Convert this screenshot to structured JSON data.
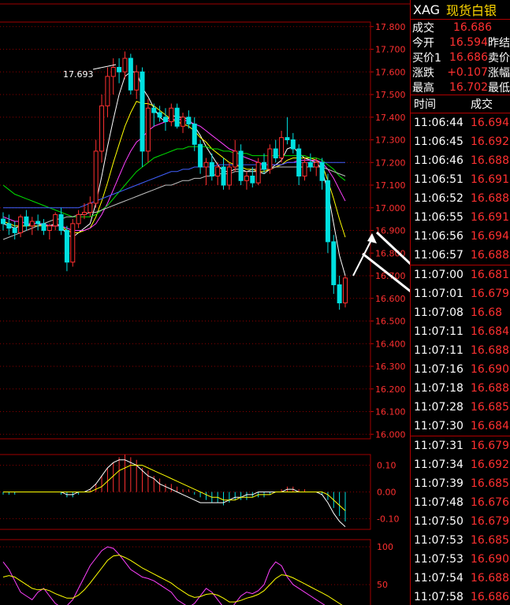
{
  "header": {
    "symbol": "XAG",
    "name": "现货白银"
  },
  "quote": [
    {
      "label": "成交",
      "value": "16.686",
      "label2": ""
    },
    {
      "label": "今开",
      "value": "16.594",
      "label2": "昨结"
    },
    {
      "label": "买价1",
      "value": "16.686",
      "label2": "卖价"
    },
    {
      "label": "涨跌",
      "value": "+0.107",
      "label2": "涨幅"
    },
    {
      "label": "最高",
      "value": "16.702",
      "label2": "最低"
    }
  ],
  "ticks_header": {
    "time": "时间",
    "price": "成交"
  },
  "ticks": [
    {
      "time": "11:06:44",
      "price": "16.694"
    },
    {
      "time": "11:06:45",
      "price": "16.692"
    },
    {
      "time": "11:06:46",
      "price": "16.688"
    },
    {
      "time": "11:06:51",
      "price": "16.691"
    },
    {
      "time": "11:06:52",
      "price": "16.688"
    },
    {
      "time": "11:06:55",
      "price": "16.691"
    },
    {
      "time": "11:06:56",
      "price": "16.694"
    },
    {
      "time": "11:06:57",
      "price": "16.688"
    },
    {
      "time": "11:07:00",
      "price": "16.681"
    },
    {
      "time": "11:07:01",
      "price": "16.679"
    },
    {
      "time": "11:07:08",
      "price": "16.68"
    },
    {
      "time": "11:07:11",
      "price": "16.684"
    },
    {
      "time": "11:07:11",
      "price": "16.688"
    },
    {
      "time": "11:07:16",
      "price": "16.690"
    },
    {
      "time": "11:07:18",
      "price": "16.688"
    },
    {
      "time": "11:07:28",
      "price": "16.685"
    },
    {
      "time": "11:07:30",
      "price": "16.684"
    },
    {
      "time": "11:07:31",
      "price": "16.679"
    },
    {
      "time": "11:07:34",
      "price": "16.692"
    },
    {
      "time": "11:07:39",
      "price": "16.685"
    },
    {
      "time": "11:07:48",
      "price": "16.676"
    },
    {
      "time": "11:07:50",
      "price": "16.679"
    },
    {
      "time": "11:07:53",
      "price": "16.685"
    },
    {
      "time": "11:07:53",
      "price": "16.690"
    },
    {
      "time": "11:07:54",
      "price": "16.688"
    },
    {
      "time": "11:07:58",
      "price": "16.686"
    }
  ],
  "chart_data": {
    "type": "candlestick",
    "high_marker": "17.693",
    "price_axis": [
      "17.800",
      "17.700",
      "17.600",
      "17.500",
      "17.400",
      "17.300",
      "17.200",
      "17.100",
      "17.000",
      "16.900",
      "16.800",
      "16.700",
      "16.600",
      "16.500",
      "16.400",
      "16.300",
      "16.200",
      "16.100",
      "16.000"
    ],
    "ylim": [
      15.98,
      17.82
    ],
    "macd_axis": [
      "0.10",
      "0.00",
      "-0.10"
    ],
    "macd_ylim": [
      -0.14,
      0.14
    ],
    "kdj_axis": [
      "100",
      "50",
      "0"
    ],
    "kdj_ylim": [
      0,
      120
    ],
    "candles": [
      [
        16.95,
        16.98,
        16.9,
        16.93
      ],
      [
        16.93,
        16.97,
        16.88,
        16.91
      ],
      [
        16.91,
        16.94,
        16.86,
        16.89
      ],
      [
        16.89,
        16.97,
        16.87,
        16.96
      ],
      [
        16.96,
        16.99,
        16.9,
        16.92
      ],
      [
        16.92,
        16.96,
        16.88,
        16.94
      ],
      [
        16.94,
        16.97,
        16.9,
        16.93
      ],
      [
        16.93,
        16.95,
        16.88,
        16.9
      ],
      [
        16.9,
        16.93,
        16.86,
        16.92
      ],
      [
        16.92,
        16.98,
        16.9,
        16.97
      ],
      [
        16.97,
        17.0,
        16.88,
        16.9
      ],
      [
        16.9,
        16.92,
        16.72,
        16.76
      ],
      [
        16.76,
        16.95,
        16.74,
        16.93
      ],
      [
        16.93,
        16.99,
        16.91,
        16.97
      ],
      [
        16.97,
        17.02,
        16.95,
        16.98
      ],
      [
        16.98,
        17.05,
        16.96,
        17.02
      ],
      [
        17.02,
        17.3,
        17.0,
        17.25
      ],
      [
        17.25,
        17.5,
        17.2,
        17.45
      ],
      [
        17.45,
        17.62,
        17.4,
        17.58
      ],
      [
        17.58,
        17.66,
        17.5,
        17.62
      ],
      [
        17.62,
        17.66,
        17.55,
        17.6
      ],
      [
        17.6,
        17.69,
        17.57,
        17.66
      ],
      [
        17.66,
        17.68,
        17.5,
        17.52
      ],
      [
        17.52,
        17.63,
        17.48,
        17.6
      ],
      [
        17.6,
        17.62,
        17.18,
        17.25
      ],
      [
        17.25,
        17.48,
        17.2,
        17.44
      ],
      [
        17.44,
        17.46,
        17.36,
        17.42
      ],
      [
        17.42,
        17.45,
        17.38,
        17.4
      ],
      [
        17.4,
        17.44,
        17.34,
        17.38
      ],
      [
        17.38,
        17.46,
        17.36,
        17.44
      ],
      [
        17.44,
        17.46,
        17.35,
        17.36
      ],
      [
        17.36,
        17.42,
        17.33,
        17.4
      ],
      [
        17.4,
        17.43,
        17.35,
        17.37
      ],
      [
        17.37,
        17.4,
        17.25,
        17.28
      ],
      [
        17.28,
        17.3,
        17.15,
        17.18
      ],
      [
        17.18,
        17.22,
        17.1,
        17.2
      ],
      [
        17.2,
        17.24,
        17.12,
        17.14
      ],
      [
        17.14,
        17.2,
        17.1,
        17.18
      ],
      [
        17.18,
        17.22,
        17.08,
        17.1
      ],
      [
        17.1,
        17.2,
        17.08,
        17.18
      ],
      [
        17.18,
        17.3,
        17.16,
        17.25
      ],
      [
        17.25,
        17.28,
        17.1,
        17.12
      ],
      [
        17.12,
        17.16,
        17.08,
        17.14
      ],
      [
        17.14,
        17.18,
        17.09,
        17.11
      ],
      [
        17.11,
        17.22,
        17.1,
        17.2
      ],
      [
        17.2,
        17.24,
        17.15,
        17.17
      ],
      [
        17.17,
        17.28,
        17.15,
        17.26
      ],
      [
        17.26,
        17.3,
        17.2,
        17.22
      ],
      [
        17.22,
        17.34,
        17.2,
        17.31
      ],
      [
        17.31,
        17.4,
        17.28,
        17.3
      ],
      [
        17.3,
        17.33,
        17.24,
        17.26
      ],
      [
        17.26,
        17.28,
        17.1,
        17.14
      ],
      [
        17.14,
        17.22,
        17.12,
        17.2
      ],
      [
        17.2,
        17.24,
        17.16,
        17.18
      ],
      [
        17.18,
        17.22,
        17.14,
        17.2
      ],
      [
        17.2,
        17.22,
        17.08,
        17.12
      ],
      [
        17.12,
        17.15,
        16.8,
        16.85
      ],
      [
        16.85,
        16.88,
        16.62,
        16.66
      ],
      [
        16.66,
        16.7,
        16.55,
        16.58
      ],
      [
        16.58,
        16.7,
        16.56,
        16.69
      ]
    ],
    "ma_series": [
      {
        "color": "#ffffff",
        "values": [
          16.93,
          16.92,
          16.91,
          16.92,
          16.92,
          16.93,
          16.93,
          16.92,
          16.92,
          16.93,
          16.92,
          16.88,
          16.87,
          16.89,
          16.91,
          16.93,
          17.02,
          17.14,
          17.27,
          17.39,
          17.5,
          17.58,
          17.6,
          17.6,
          17.53,
          17.49,
          17.44,
          17.4,
          17.38,
          17.41,
          17.4,
          17.4,
          17.39,
          17.36,
          17.32,
          17.27,
          17.23,
          17.19,
          17.16,
          17.16,
          17.17,
          17.17,
          17.16,
          17.16,
          17.16,
          17.15,
          17.17,
          17.19,
          17.21,
          17.26,
          17.27,
          17.24,
          17.22,
          17.21,
          17.2,
          17.17,
          17.07,
          16.93,
          16.79,
          16.7
        ]
      },
      {
        "color": "#ffff00",
        "values": [
          16.94,
          16.93,
          16.92,
          16.92,
          16.92,
          16.92,
          16.92,
          16.92,
          16.92,
          16.92,
          16.92,
          16.9,
          16.89,
          16.89,
          16.9,
          16.91,
          16.96,
          17.03,
          17.11,
          17.2,
          17.28,
          17.36,
          17.42,
          17.47,
          17.46,
          17.46,
          17.45,
          17.43,
          17.41,
          17.39,
          17.38,
          17.37,
          17.36,
          17.34,
          17.31,
          17.29,
          17.26,
          17.24,
          17.22,
          17.2,
          17.19,
          17.18,
          17.17,
          17.17,
          17.16,
          17.16,
          17.17,
          17.18,
          17.19,
          17.21,
          17.22,
          17.22,
          17.22,
          17.22,
          17.21,
          17.19,
          17.12,
          17.04,
          16.95,
          16.87
        ]
      },
      {
        "color": "#ff40ff",
        "values": [
          16.96,
          16.95,
          16.94,
          16.94,
          16.93,
          16.93,
          16.93,
          16.93,
          16.92,
          16.92,
          16.92,
          16.91,
          16.9,
          16.9,
          16.9,
          16.91,
          16.93,
          16.97,
          17.02,
          17.08,
          17.14,
          17.2,
          17.25,
          17.29,
          17.31,
          17.34,
          17.36,
          17.37,
          17.38,
          17.39,
          17.39,
          17.39,
          17.38,
          17.37,
          17.36,
          17.34,
          17.32,
          17.3,
          17.28,
          17.26,
          17.25,
          17.23,
          17.22,
          17.21,
          17.2,
          17.19,
          17.19,
          17.19,
          17.19,
          17.2,
          17.2,
          17.21,
          17.21,
          17.21,
          17.21,
          17.2,
          17.17,
          17.13,
          17.08,
          17.03
        ]
      },
      {
        "color": "#00e000",
        "values": [
          17.1,
          17.08,
          17.06,
          17.05,
          17.04,
          17.03,
          17.02,
          17.01,
          17.0,
          16.99,
          16.98,
          16.97,
          16.96,
          16.96,
          16.96,
          16.96,
          16.97,
          16.99,
          17.01,
          17.04,
          17.07,
          17.1,
          17.13,
          17.16,
          17.18,
          17.2,
          17.22,
          17.23,
          17.24,
          17.25,
          17.26,
          17.26,
          17.27,
          17.27,
          17.27,
          17.27,
          17.26,
          17.26,
          17.25,
          17.25,
          17.24,
          17.24,
          17.24,
          17.23,
          17.23,
          17.23,
          17.23,
          17.23,
          17.23,
          17.23,
          17.23,
          17.23,
          17.23,
          17.22,
          17.22,
          17.21,
          17.19,
          17.17,
          17.14,
          17.12
        ]
      },
      {
        "color": "#4060ff",
        "values": [
          17.0,
          17.0,
          17.0,
          17.0,
          17.0,
          17.0,
          17.0,
          17.0,
          17.0,
          17.0,
          17.0,
          17.0,
          17.0,
          17.0,
          17.01,
          17.02,
          17.03,
          17.04,
          17.05,
          17.06,
          17.07,
          17.08,
          17.09,
          17.1,
          17.11,
          17.12,
          17.13,
          17.14,
          17.15,
          17.16,
          17.16,
          17.17,
          17.17,
          17.18,
          17.18,
          17.18,
          17.18,
          17.19,
          17.19,
          17.19,
          17.19,
          17.19,
          17.19,
          17.19,
          17.19,
          17.19,
          17.19,
          17.19,
          17.19,
          17.2,
          17.2,
          17.2,
          17.2,
          17.2,
          17.2,
          17.2,
          17.2,
          17.2,
          17.2,
          17.2
        ]
      },
      {
        "color": "#c0c0c0",
        "values": [
          16.86,
          16.87,
          16.88,
          16.89,
          16.9,
          16.91,
          16.92,
          16.93,
          16.94,
          16.95,
          16.95,
          16.96,
          16.96,
          16.97,
          16.97,
          16.98,
          16.98,
          16.99,
          17.0,
          17.01,
          17.02,
          17.03,
          17.04,
          17.05,
          17.06,
          17.07,
          17.08,
          17.09,
          17.1,
          17.1,
          17.11,
          17.12,
          17.12,
          17.13,
          17.13,
          17.14,
          17.14,
          17.15,
          17.15,
          17.15,
          17.16,
          17.16,
          17.16,
          17.17,
          17.17,
          17.17,
          17.17,
          17.18,
          17.18,
          17.18,
          17.18,
          17.18,
          17.18,
          17.18,
          17.18,
          17.18,
          17.17,
          17.16,
          17.15,
          17.14
        ]
      }
    ],
    "macd_hist": [
      -0.01,
      -0.01,
      -0.01,
      0,
      0,
      0,
      0,
      0,
      0,
      0,
      -0.01,
      -0.02,
      -0.02,
      -0.01,
      0,
      0.01,
      0.03,
      0.06,
      0.09,
      0.11,
      0.13,
      0.14,
      0.13,
      0.12,
      0.09,
      0.08,
      0.06,
      0.05,
      0.03,
      0.03,
      0.02,
      0.01,
      0.01,
      -0.01,
      -0.02,
      -0.03,
      -0.04,
      -0.04,
      -0.05,
      -0.04,
      -0.03,
      -0.03,
      -0.03,
      -0.02,
      -0.02,
      -0.02,
      -0.01,
      0,
      0.01,
      0.02,
      0.02,
      0.01,
      0.01,
      0,
      0,
      -0.01,
      -0.03,
      -0.06,
      -0.09,
      -0.11
    ],
    "macd_dif": [
      0,
      0,
      0,
      0,
      0,
      0,
      0,
      0,
      0,
      0,
      0,
      -0.01,
      -0.01,
      0,
      0,
      0.01,
      0.03,
      0.06,
      0.09,
      0.11,
      0.12,
      0.12,
      0.11,
      0.1,
      0.08,
      0.06,
      0.05,
      0.03,
      0.02,
      0.01,
      0,
      -0.01,
      -0.02,
      -0.03,
      -0.04,
      -0.04,
      -0.04,
      -0.04,
      -0.04,
      -0.03,
      -0.02,
      -0.02,
      -0.01,
      -0.01,
      0,
      0,
      0,
      0,
      0,
      0.01,
      0.01,
      0,
      0,
      0,
      0,
      -0.01,
      -0.04,
      -0.08,
      -0.11,
      -0.13
    ],
    "macd_dea": [
      0,
      0,
      0,
      0,
      0,
      0,
      0,
      0,
      0,
      0,
      0,
      0,
      0,
      0,
      0,
      0,
      0.01,
      0.02,
      0.04,
      0.06,
      0.08,
      0.09,
      0.1,
      0.1,
      0.1,
      0.09,
      0.08,
      0.07,
      0.06,
      0.05,
      0.04,
      0.03,
      0.02,
      0.01,
      0,
      -0.01,
      -0.02,
      -0.02,
      -0.03,
      -0.03,
      -0.03,
      -0.02,
      -0.02,
      -0.02,
      -0.01,
      -0.01,
      -0.01,
      0,
      0,
      0,
      0,
      0,
      0,
      0,
      0,
      0,
      -0.01,
      -0.03,
      -0.05,
      -0.07
    ],
    "kdj_k": [
      80,
      70,
      55,
      40,
      35,
      30,
      40,
      45,
      35,
      25,
      20,
      22,
      30,
      45,
      60,
      75,
      85,
      95,
      100,
      98,
      90,
      80,
      70,
      65,
      60,
      58,
      55,
      50,
      45,
      40,
      30,
      25,
      20,
      25,
      35,
      45,
      40,
      30,
      20,
      15,
      25,
      35,
      40,
      38,
      42,
      50,
      70,
      80,
      75,
      60,
      50,
      45,
      40,
      35,
      30,
      25,
      20,
      15,
      12,
      15
    ],
    "kdj_d": [
      60,
      62,
      60,
      55,
      50,
      45,
      43,
      44,
      42,
      38,
      35,
      32,
      32,
      36,
      43,
      52,
      62,
      72,
      82,
      88,
      89,
      86,
      82,
      77,
      72,
      68,
      64,
      60,
      56,
      52,
      46,
      41,
      36,
      33,
      34,
      37,
      38,
      36,
      32,
      27,
      27,
      29,
      32,
      34,
      37,
      42,
      50,
      58,
      63,
      62,
      59,
      55,
      51,
      47,
      43,
      39,
      35,
      30,
      25,
      20
    ]
  }
}
